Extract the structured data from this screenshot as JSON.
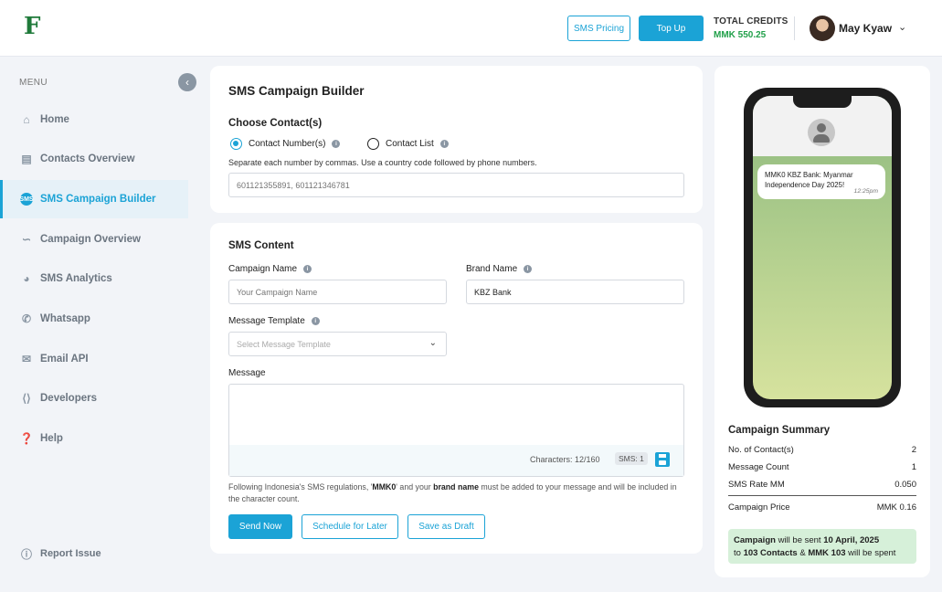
{
  "header": {
    "logo": "F",
    "sms_pricing": "SMS Pricing",
    "top_up": "Top Up",
    "credits_label": "TOTAL CREDITS",
    "credits_value": "MMK 550.25",
    "user_name": "May Kyaw"
  },
  "sidebar": {
    "menu_label": "MENU",
    "items": [
      {
        "label": "Home",
        "icon": "home-icon"
      },
      {
        "label": "Contacts Overview",
        "icon": "contacts-icon"
      },
      {
        "label": "SMS Campaign Builder",
        "icon": "sms-icon"
      },
      {
        "label": "Campaign Overview",
        "icon": "chart-icon"
      },
      {
        "label": "SMS  Analytics",
        "icon": "analytics-icon"
      },
      {
        "label": "Whatsapp",
        "icon": "whatsapp-icon"
      },
      {
        "label": "Email API",
        "icon": "email-icon"
      },
      {
        "label": "Developers",
        "icon": "code-icon"
      },
      {
        "label": "Help",
        "icon": "help-icon"
      }
    ],
    "active_index": 2,
    "report_issue": "Report Issue"
  },
  "builder": {
    "title": "SMS Campaign Builder",
    "choose_contacts": "Choose Contact(s)",
    "radio_numbers": "Contact Number(s)",
    "radio_list": "Contact List",
    "helper": "Separate each number by commas. Use a country code followed by phone numbers.",
    "numbers_placeholder": "601121355891, 601121346781"
  },
  "content": {
    "title": "SMS Content",
    "campaign_name_label": "Campaign Name",
    "campaign_name_placeholder": "Your Campaign Name",
    "brand_name_label": "Brand Name",
    "brand_name_value": "KBZ Bank",
    "template_label": "Message Template",
    "template_placeholder": "Select Message Template",
    "message_label": "Message",
    "characters": "Characters: 12/160",
    "sms_count": "SMS: 1",
    "note_pre": "Following Indonesia's SMS regulations, '",
    "note_bold1": "MMK0",
    "note_mid": "' and your ",
    "note_bold2": "brand name",
    "note_post": " must be added to your message and will be included in the character count.",
    "send_now": "Send Now",
    "schedule": "Schedule for Later",
    "save_draft": "Save as Draft"
  },
  "preview": {
    "message": "MMK0 KBZ Bank: Myanmar Independence Day 2025!",
    "time": "12:25pm"
  },
  "summary": {
    "title": "Campaign Summary",
    "rows": [
      {
        "label": "No. of Contact(s)",
        "value": "2"
      },
      {
        "label": "Message Count",
        "value": "1"
      },
      {
        "label": "SMS Rate MM",
        "value": "0.050"
      }
    ],
    "price_label": "Campaign Price",
    "price_value": "MMK  0.16",
    "banner_b1": "Campaign",
    "banner_t1": " will be sent ",
    "banner_b2": "10 April, 2025",
    "banner_t2": "to ",
    "banner_b3": "103 Contacts",
    "banner_t3": " & ",
    "banner_b4": "MMK 103",
    "banner_t4": " will be spent"
  }
}
